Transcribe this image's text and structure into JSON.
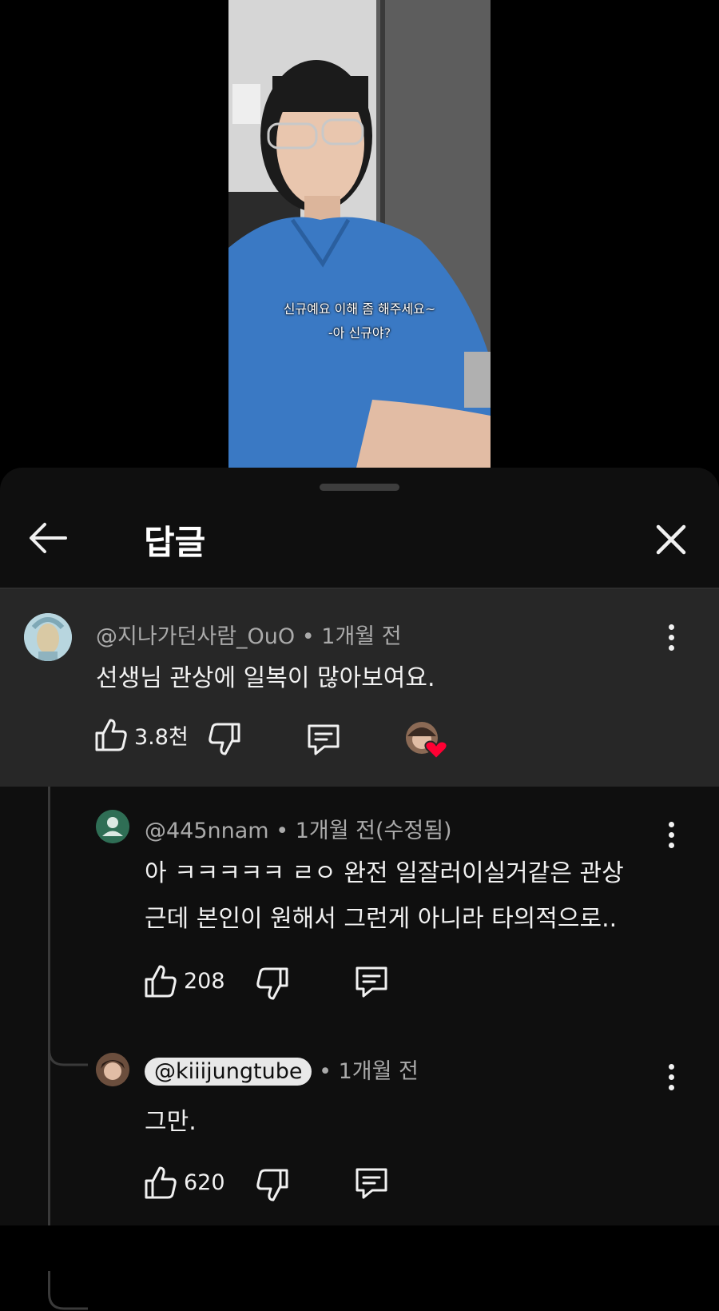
{
  "video": {
    "subtitle_line1": "신규예요 이해 좀 해주세요~",
    "subtitle_line2": "-아 신규야?"
  },
  "sheet": {
    "title": "답글",
    "back_icon": "arrow-left-icon",
    "close_icon": "close-icon"
  },
  "comment": {
    "author": "@지나가던사람_OuO",
    "time": "1개월 전",
    "text": "선생님 관상에 일복이 많아보여요.",
    "likes": "3.8천",
    "creator_heart": true
  },
  "replies": [
    {
      "author": "@445nnam",
      "time": "1개월 전(수정됨)",
      "text_line1": "아 ㅋㅋㅋㅋㅋ ㄹㅇ 완전 일잘러이실거같은 관상",
      "text_line2": "근데 본인이 원해서 그런게 아니라 타의적으로..",
      "likes": "208"
    },
    {
      "author": "@kiiijungtube",
      "time": "1개월 전",
      "text_line1": "그만.",
      "likes": "620",
      "is_creator": true
    }
  ],
  "colors": {
    "sheet_bg": "#0f0f0f",
    "highlight_bg": "#272727",
    "meta_text": "#aaaaaa",
    "heart": "#ff0033",
    "mention_bg": "#e8e8e8"
  }
}
